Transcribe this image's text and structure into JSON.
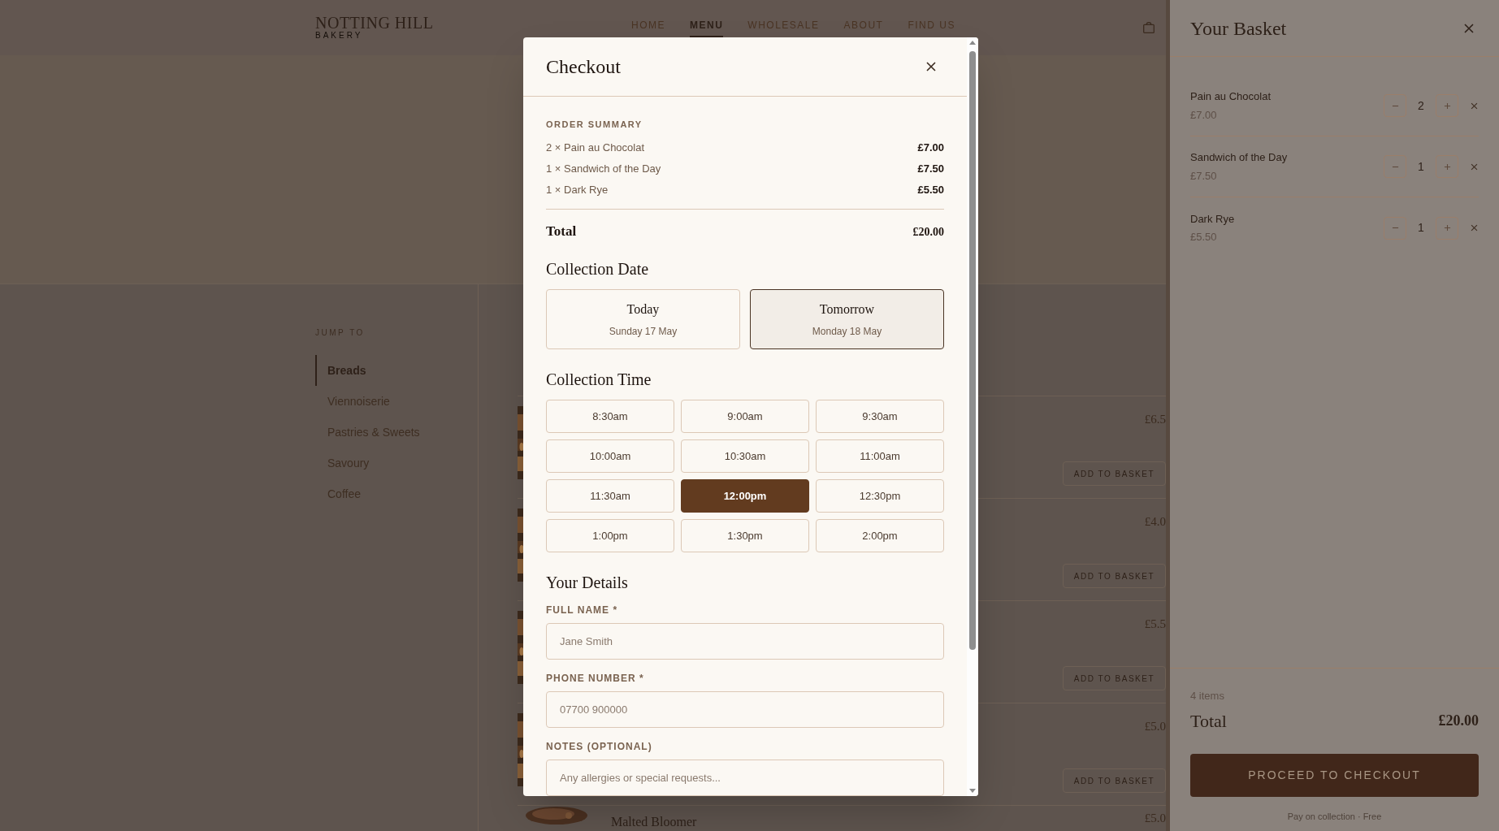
{
  "header": {
    "brand": "NOTTING HILL",
    "brand_sub": "BAKERY",
    "nav": [
      {
        "label": "HOME",
        "selected": false
      },
      {
        "label": "MENU",
        "selected": true
      },
      {
        "label": "WHOLESALE",
        "selected": false
      },
      {
        "label": "ABOUT",
        "selected": false
      },
      {
        "label": "FIND US",
        "selected": false
      }
    ]
  },
  "sidebar": {
    "heading": "JUMP TO",
    "items": [
      {
        "label": "Breads",
        "selected": true
      },
      {
        "label": "Viennoiserie",
        "selected": false
      },
      {
        "label": "Pastries & Sweets",
        "selected": false
      },
      {
        "label": "Savoury",
        "selected": false
      },
      {
        "label": "Coffee",
        "selected": false
      }
    ]
  },
  "products": [
    {
      "price": "£6.5",
      "button": "ADD TO BASKET"
    },
    {
      "price": "£4.0",
      "button": "ADD TO BASKET"
    },
    {
      "price": "£5.5",
      "button": "ADD TO BASKET"
    },
    {
      "price": "£5.0",
      "button": "ADD TO BASKET"
    },
    {
      "name": "Malted Bloomer",
      "price": "£5.0"
    }
  ],
  "checkout": {
    "title": "Checkout",
    "summary_heading": "ORDER SUMMARY",
    "lines": [
      {
        "label": "2 × Pain au Chocolat",
        "amount": "£7.00"
      },
      {
        "label": "1 × Sandwich of the Day",
        "amount": "£7.50"
      },
      {
        "label": "1 × Dark Rye",
        "amount": "£5.50"
      }
    ],
    "total_label": "Total",
    "total": "£20.00",
    "date_heading": "Collection Date",
    "dates": [
      {
        "label": "Today",
        "sub": "Sunday 17 May",
        "selected": false
      },
      {
        "label": "Tomorrow",
        "sub": "Monday 18 May",
        "selected": true
      }
    ],
    "time_heading": "Collection Time",
    "times": [
      {
        "label": "8:30am",
        "selected": false
      },
      {
        "label": "9:00am",
        "selected": false
      },
      {
        "label": "9:30am",
        "selected": false
      },
      {
        "label": "10:00am",
        "selected": false
      },
      {
        "label": "10:30am",
        "selected": false
      },
      {
        "label": "11:00am",
        "selected": false
      },
      {
        "label": "11:30am",
        "selected": false
      },
      {
        "label": "12:00pm",
        "selected": true
      },
      {
        "label": "12:30pm",
        "selected": false
      },
      {
        "label": "1:00pm",
        "selected": false
      },
      {
        "label": "1:30pm",
        "selected": false
      },
      {
        "label": "2:00pm",
        "selected": false
      }
    ],
    "details_heading": "Your Details",
    "fields": [
      {
        "label": "FULL NAME *",
        "placeholder": "Jane Smith"
      },
      {
        "label": "PHONE NUMBER *",
        "placeholder": "07700 900000"
      },
      {
        "label": "NOTES (OPTIONAL)",
        "placeholder": "Any allergies or special requests..."
      }
    ]
  },
  "basket": {
    "title": "Your Basket",
    "items": [
      {
        "name": "Pain au Chocolat",
        "price": "£7.00",
        "qty": "2"
      },
      {
        "name": "Sandwich of the Day",
        "price": "£7.50",
        "qty": "1"
      },
      {
        "name": "Dark Rye",
        "price": "£5.50",
        "qty": "1"
      }
    ],
    "count": "4 items",
    "total_label": "Total",
    "total": "£20.00",
    "button": "PROCEED TO CHECKOUT",
    "note": "Pay on collection · Free"
  }
}
